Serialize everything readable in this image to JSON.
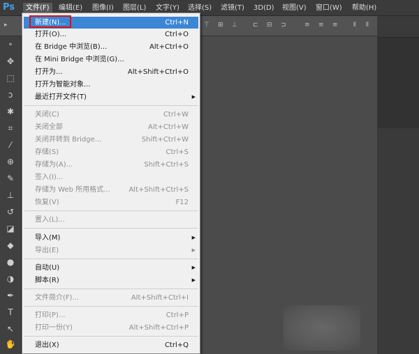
{
  "app": {
    "logo": "Ps"
  },
  "menubar": {
    "items": [
      "文件(F)",
      "编辑(E)",
      "图像(I)",
      "图层(L)",
      "文字(Y)",
      "选择(S)",
      "滤镜(T)",
      "3D(D)",
      "视图(V)",
      "窗口(W)",
      "帮助(H)"
    ]
  },
  "file_menu": {
    "items": [
      {
        "label": "新建(N)...",
        "shortcut": "Ctrl+N",
        "state": "highlighted"
      },
      {
        "label": "打开(O)...",
        "shortcut": "Ctrl+O"
      },
      {
        "label": "在 Bridge 中浏览(B)...",
        "shortcut": "Alt+Ctrl+O"
      },
      {
        "label": "在 Mini Bridge 中浏览(G)...",
        "shortcut": ""
      },
      {
        "label": "打开为...",
        "shortcut": "Alt+Shift+Ctrl+O"
      },
      {
        "label": "打开为智能对象...",
        "shortcut": ""
      },
      {
        "label": "最近打开文件(T)",
        "shortcut": "",
        "submenu": true
      },
      {
        "label": "关闭(C)",
        "shortcut": "Ctrl+W",
        "state": "disabled"
      },
      {
        "label": "关闭全部",
        "shortcut": "Alt+Ctrl+W",
        "state": "disabled"
      },
      {
        "label": "关闭并转到 Bridge...",
        "shortcut": "Shift+Ctrl+W",
        "state": "disabled"
      },
      {
        "label": "存储(S)",
        "shortcut": "Ctrl+S",
        "state": "disabled"
      },
      {
        "label": "存储为(A)...",
        "shortcut": "Shift+Ctrl+S",
        "state": "disabled"
      },
      {
        "label": "签入(I)...",
        "shortcut": "",
        "state": "disabled"
      },
      {
        "label": "存储为 Web 所用格式...",
        "shortcut": "Alt+Shift+Ctrl+S",
        "state": "disabled"
      },
      {
        "label": "恢复(V)",
        "shortcut": "F12",
        "state": "disabled"
      },
      {
        "label": "置入(L)...",
        "shortcut": "",
        "state": "disabled"
      },
      {
        "label": "导入(M)",
        "shortcut": "",
        "submenu": true
      },
      {
        "label": "导出(E)",
        "shortcut": "",
        "submenu": true,
        "state": "disabled"
      },
      {
        "label": "自动(U)",
        "shortcut": "",
        "submenu": true
      },
      {
        "label": "脚本(R)",
        "shortcut": "",
        "submenu": true
      },
      {
        "label": "文件简介(F)...",
        "shortcut": "Alt+Shift+Ctrl+I",
        "state": "disabled"
      },
      {
        "label": "打印(P)...",
        "shortcut": "Ctrl+P",
        "state": "disabled"
      },
      {
        "label": "打印一份(Y)",
        "shortcut": "Alt+Shift+Ctrl+P",
        "state": "disabled"
      },
      {
        "label": "退出(X)",
        "shortcut": "Ctrl+Q"
      }
    ]
  },
  "colors": {
    "highlight": "#3c86d6",
    "annotation_box": "#e01010",
    "menu_bg": "#f0f0f0",
    "app_bg": "#4a4a4a"
  }
}
